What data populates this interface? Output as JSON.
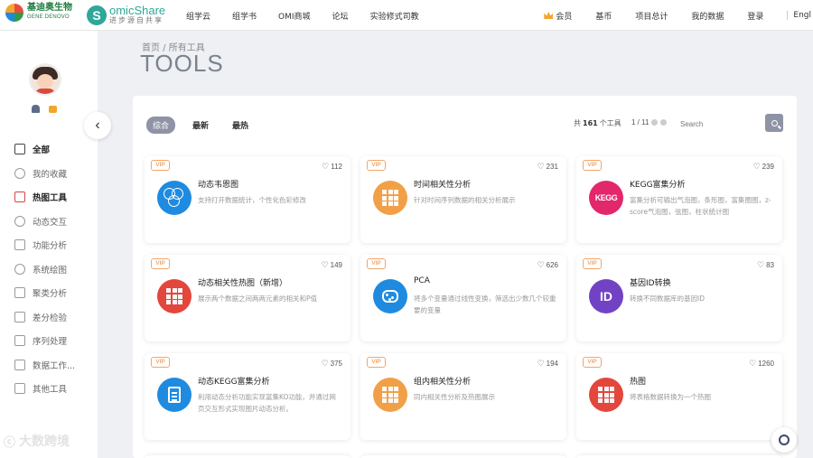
{
  "brand": {
    "logo1_cn": "基迪奥生物",
    "logo1_en": "GENE DENOVO",
    "logo2_name": "omicShare",
    "logo2_letter": "S",
    "logo2_sub": "进步源自共享"
  },
  "nav": {
    "items": [
      "组学云",
      "组学书",
      "OMI商城",
      "论坛",
      "实验修式司教"
    ],
    "right": {
      "vip": "会员",
      "coins": "基币",
      "projects": "项目总计",
      "my_data": "我的数据",
      "login": "登录",
      "lang": "Engl"
    }
  },
  "sidebar": {
    "items": [
      {
        "label": "全部",
        "icon": "grid-icon"
      },
      {
        "label": "我的收藏",
        "icon": "star-icon"
      },
      {
        "label": "热图工具",
        "icon": "heatmap-icon"
      },
      {
        "label": "动态交互",
        "icon": "interactive-icon"
      },
      {
        "label": "功能分析",
        "icon": "function-icon"
      },
      {
        "label": "系统绘图",
        "icon": "circles-icon"
      },
      {
        "label": "聚类分析",
        "icon": "cluster-icon"
      },
      {
        "label": "差分检验",
        "icon": "bar-icon"
      },
      {
        "label": "序列处理",
        "icon": "sequence-icon"
      },
      {
        "label": "数据工作...",
        "icon": "table-icon"
      },
      {
        "label": "其他工具",
        "icon": "tools-icon"
      }
    ]
  },
  "header": {
    "breadcrumb": "首页 / 所有工具",
    "title": "TOOLS"
  },
  "filters": {
    "tabs": [
      "综合",
      "最新",
      "最热"
    ],
    "count_prefix": "共",
    "count": "161",
    "count_suffix": "个工具",
    "pager": "1 / 11",
    "search_placeholder": "Search"
  },
  "cards": [
    {
      "vip": "VIP",
      "likes": "112",
      "title": "动态韦恩图",
      "desc": "支持打开数据统计，个性化色彩修改",
      "icon": "venn-icon",
      "color": "#1f8be0"
    },
    {
      "vip": "VIP",
      "likes": "231",
      "title": "时间相关性分析",
      "desc": "针对时间序列数据的相关分析展示",
      "icon": "heatmap-grid-icon",
      "color": "#f1a047"
    },
    {
      "vip": "VIP",
      "likes": "239",
      "title": "KEGG富集分析",
      "desc": "富集分析可输出气泡图，条形图，富集圈图，z-score气泡图，弦图，柱状统计图",
      "icon": "kegg-icon",
      "color": "#e2286b"
    },
    {
      "vip": "VIP",
      "likes": "149",
      "title": "动态相关性热图（新增）",
      "desc": "展示两个数据之间两两元素的相关和P值",
      "icon": "correlation-heatmap-icon",
      "color": "#e3463c"
    },
    {
      "vip": "VIP",
      "likes": "626",
      "title": "PCA",
      "desc": "将多个变量通过线性变换，筛选出少数几个较重要的变量",
      "icon": "pca-icon",
      "color": "#1f8be0"
    },
    {
      "vip": "VIP",
      "likes": "83",
      "title": "基因ID转换",
      "desc": "转换不同数据库的基因ID",
      "icon": "id-convert-icon",
      "color": "#7242c4"
    },
    {
      "vip": "VIP",
      "likes": "375",
      "title": "动态KEGG富集分析",
      "desc": "利用动态分析功能实现富集KO功能，并通过网页交互形式实现图片动态分析。",
      "icon": "document-icon",
      "color": "#1f8be0"
    },
    {
      "vip": "VIP",
      "likes": "194",
      "title": "组内相关性分析",
      "desc": "同内相关性分析及热图展示",
      "icon": "heatmap-grid-icon",
      "color": "#f1a047"
    },
    {
      "vip": "VIP",
      "likes": "1260",
      "title": "热图",
      "desc": "将表格数据转换为一个热图",
      "icon": "heatmap-icon",
      "color": "#e3463c"
    }
  ],
  "watermark": {
    "badge": "ⓒ",
    "text": "大数跨境"
  }
}
